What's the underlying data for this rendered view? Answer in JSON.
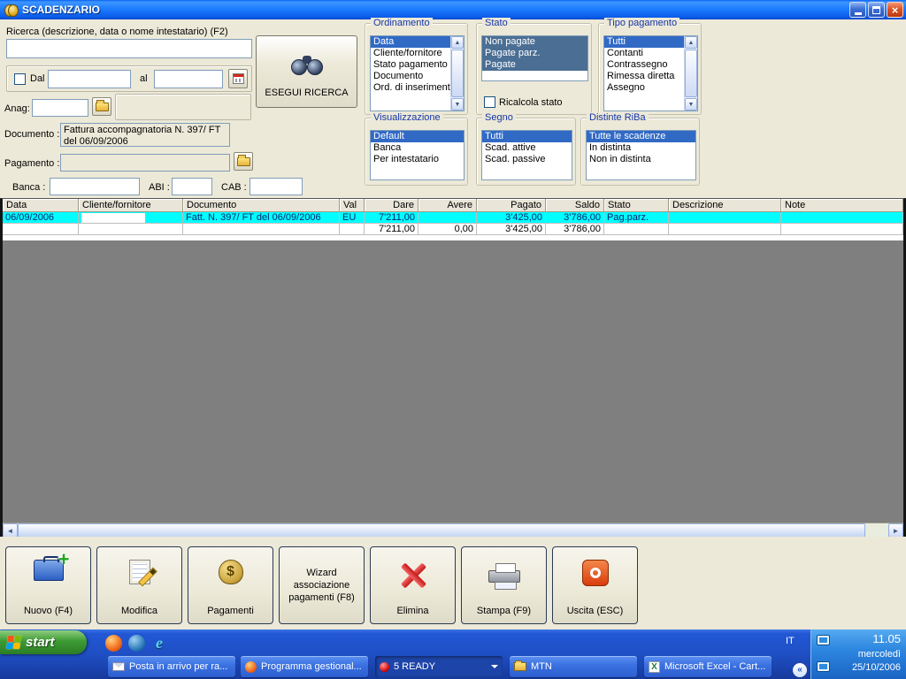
{
  "window": {
    "title": "SCADENZARIO"
  },
  "search": {
    "ricerca_label": "Ricerca (descrizione, data o nome intestatario) (F2)",
    "ricerca_value": "",
    "dal_label": "Dal",
    "al_label": "al",
    "dal_value": "",
    "al_value": "",
    "anag_label": "Anag:",
    "anag_value": "",
    "documento_label": "Documento :",
    "documento_value": "Fattura accompagnatoria N. 397/ FT del 06/09/2006",
    "pagamento_label": "Pagamento :",
    "pagamento_value": "",
    "banca_label": "Banca :",
    "banca_value": "",
    "abi_label": "ABI :",
    "abi_value": "",
    "cab_label": "CAB :",
    "cab_value": "",
    "esegui_button": "ESEGUI RICERCA"
  },
  "groups": {
    "ordinamento": {
      "title": "Ordinamento",
      "items": [
        "Data",
        "Cliente/fornitore",
        "Stato pagamento",
        "Documento",
        "Ord. di inserimento"
      ]
    },
    "stato": {
      "title": "Stato",
      "items": [
        "Non pagate",
        "Pagate parz.",
        "Pagate"
      ],
      "checkbox_label": "Ricalcola stato"
    },
    "tipo_pagamento": {
      "title": "Tipo pagamento",
      "items": [
        "Tutti",
        "Contanti",
        "Contrassegno",
        "Rimessa diretta",
        "Assegno"
      ]
    },
    "visualizzazione": {
      "title": "Visualizzazione",
      "items": [
        "Default",
        "Banca",
        "Per intestatario"
      ]
    },
    "segno": {
      "title": "Segno",
      "items": [
        "Tutti",
        "Scad. attive",
        "Scad. passive"
      ]
    },
    "distinte_riba": {
      "title": "Distinte RiBa",
      "items": [
        "Tutte le scadenze",
        "In distinta",
        "Non in distinta"
      ]
    }
  },
  "table": {
    "columns": [
      "Data",
      "Cliente/fornitore",
      "Documento",
      "Val",
      "Dare",
      "Avere",
      "Pagato",
      "Saldo",
      "Stato",
      "Descrizione",
      "Note"
    ],
    "rows": [
      [
        "06/09/2006",
        "",
        "Fatt. N. 397/ FT del 06/09/2006",
        "EU",
        "7'211,00",
        "",
        "3'425,00",
        "3'786,00",
        "Pag.parz.",
        "",
        ""
      ],
      [
        "",
        "",
        "",
        "",
        "7'211,00",
        "0,00",
        "3'425,00",
        "3'786,00",
        "",
        "",
        ""
      ]
    ]
  },
  "toolbar": {
    "nuovo": "Nuovo (F4)",
    "modifica": "Modifica",
    "pagamenti": "Pagamenti",
    "wizard": "Wizard associazione pagamenti (F8)",
    "elimina": "Elimina",
    "stampa": "Stampa (F9)",
    "uscita": "Uscita (ESC)"
  },
  "taskbar": {
    "start_label": "start",
    "buttons": [
      "Posta in arrivo per ra...",
      "Programma gestional...",
      "5 READY",
      "MTN",
      "Microsoft Excel - Cart..."
    ],
    "lang_indicator": "IT",
    "clock_time": "11.05",
    "clock_day": "mercoledì",
    "clock_date": "25/10/2006"
  },
  "icons": {
    "close": "×",
    "scroll_up": "▲",
    "scroll_down": "▼",
    "scroll_left": "◄",
    "scroll_right": "►",
    "chevron_collapse": "«",
    "dollar": "$",
    "plus": "+",
    "excel_x": "X",
    "ie_e": "e",
    "dropdown_arrow": ""
  },
  "colors": {
    "titlebar_blue": "#0A5AE6",
    "selection_blue": "#316AC5",
    "selection_inactive": "#4A6E94",
    "row_highlight_cyan": "#00FFFF",
    "taskbar_blue": "#1F4FC4",
    "start_green": "#3C9A33",
    "form_bg": "#ECE9D8"
  }
}
